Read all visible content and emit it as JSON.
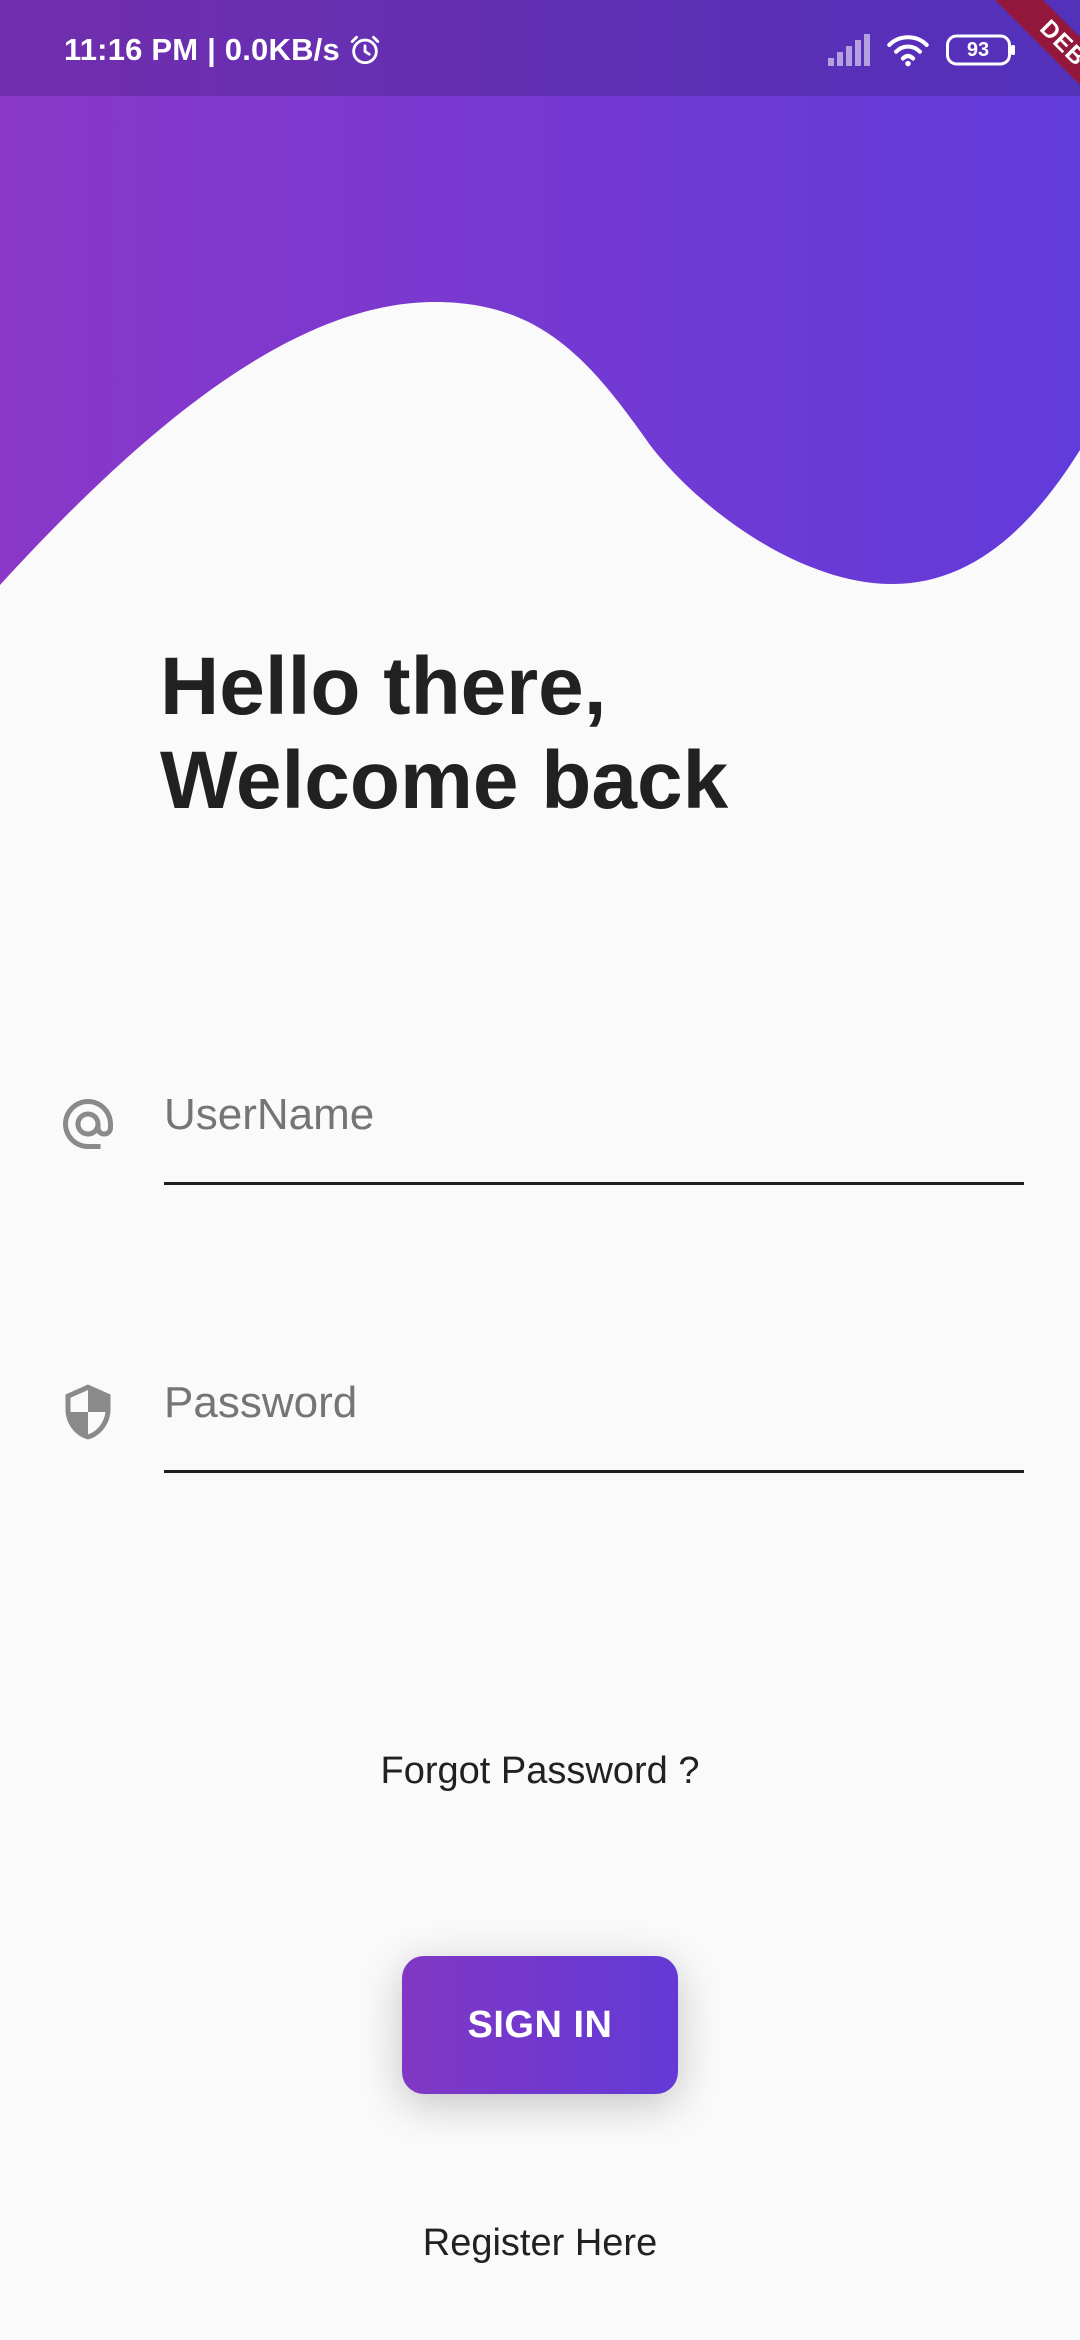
{
  "status_bar": {
    "time_speed": "11:16 PM | 0.0KB/s",
    "battery_level": "93",
    "debug_label": "DEBUG"
  },
  "colors": {
    "gradient_start": "#8a37c8",
    "gradient_end": "#613bdb",
    "background": "#fafafa",
    "text": "#212121"
  },
  "greeting": {
    "line1": "Hello there,",
    "line2": "Welcome back"
  },
  "form": {
    "username_placeholder": "UserName",
    "password_placeholder": "Password",
    "username_icon": "at-sign-icon",
    "password_icon": "shield-icon"
  },
  "actions": {
    "forgot_password": "Forgot Password ?",
    "sign_in": "SIGN IN",
    "register": "Register Here"
  }
}
